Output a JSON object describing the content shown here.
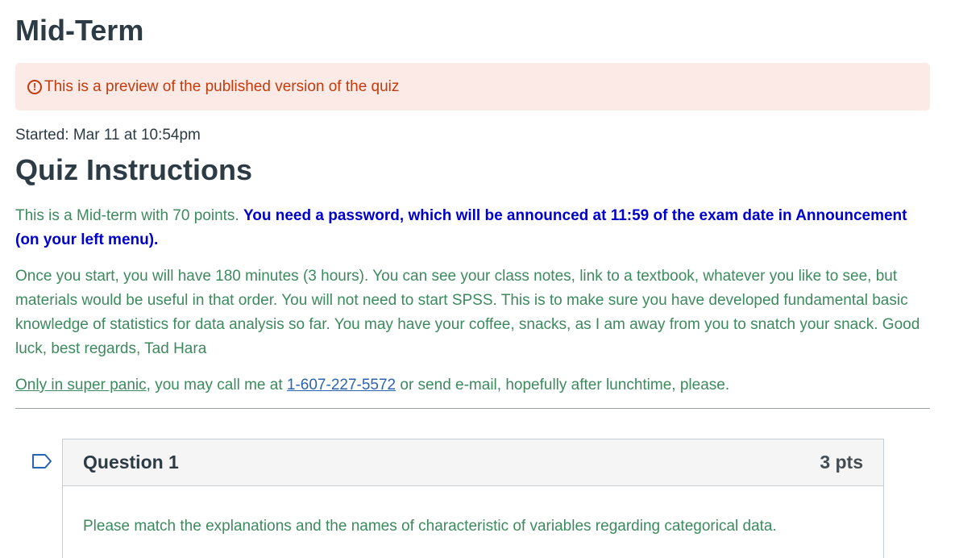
{
  "quiz": {
    "title": "Mid-Term",
    "preview_notice": "This is a preview of the published version of the quiz",
    "started": "Started: Mar 11 at 10:54pm"
  },
  "instructions": {
    "heading": "Quiz Instructions",
    "p1_plain": "This is a Mid-term with 70 points. ",
    "p1_bold": "You need a password, which will be announced at 11:59 of the exam date in Announcement (on your left menu).",
    "p2": "Once you start, you will have 180 minutes (3 hours). You can see your class notes, link to a textbook, whatever you like to see, but materials would be useful in that order. You will not need to start SPSS. This is to make sure you have developed fundamental basic knowledge of statistics for data analysis so far. You may have your coffee, snacks, as I am away from you to snatch your snack. Good luck, best regards, Tad Hara",
    "p3_link1": "Only in super panic",
    "p3_mid": ", you may call me at ",
    "p3_phone": "1-607-227-5572",
    "p3_end": " or send e-mail, hopefully after lunchtime, please."
  },
  "question": {
    "name": "Question 1",
    "points": "3 pts",
    "text": "Please match the explanations and the names of characteristic of variables regarding categorical data.",
    "flag_icon": "flag-outline-icon"
  },
  "colors": {
    "warning": "#c23c0d",
    "warning_bg": "#fbeae5",
    "instruction_green": "#3d8a5e",
    "emphasis_blue": "#0000cc",
    "link_blue": "#2a64b0"
  }
}
